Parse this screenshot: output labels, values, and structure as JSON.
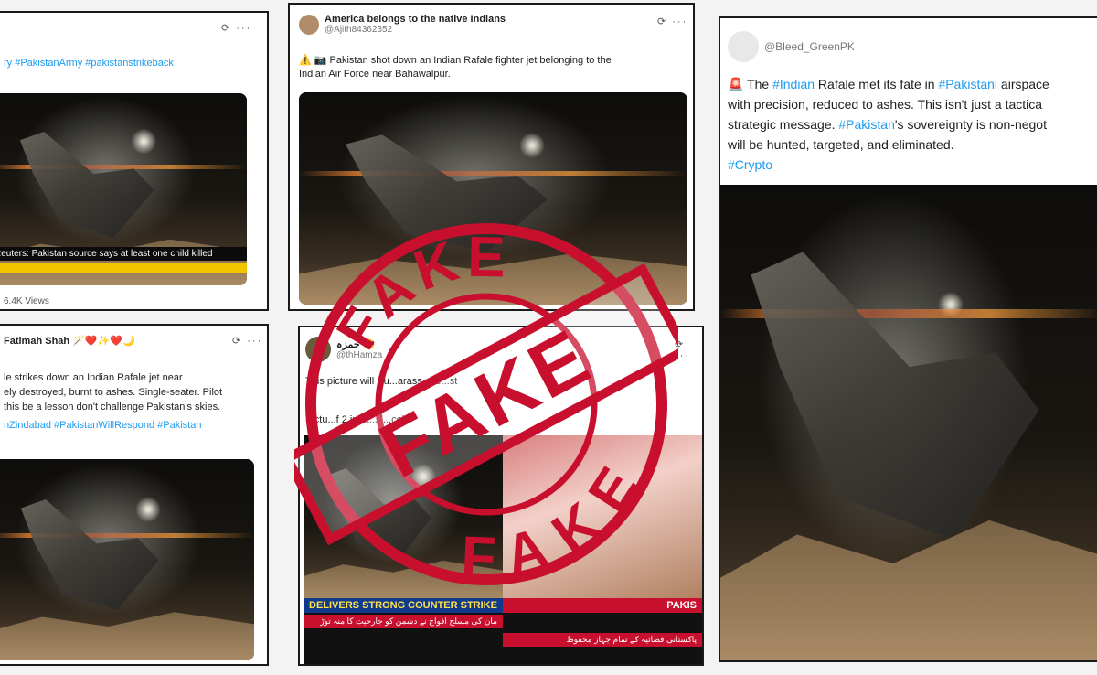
{
  "card1": {
    "tags": "ry #PakistanArmy #pakistanstrikeback",
    "news_banner": "Reuters: Pakistan source says at least one child killed",
    "ticker": "",
    "views": "6.4K Views"
  },
  "card2": {
    "name": "America belongs to the native Indians",
    "handle": "@Ajith84362352",
    "line1": "⚠️ 📷 Pakistan shot down an Indian Rafale fighter jet belonging to the",
    "line2": "Indian Air Force near Bahawalpur."
  },
  "card3": {
    "handle": "@Bleed_GreenPK",
    "line1_a": "🚨 The ",
    "line1_tag1": "#Indian",
    "line1_b": " Rafale met its fate in ",
    "line1_tag2": "#Pakistani",
    "line1_c": " airspace",
    "line2": "with precision, reduced to ashes. This isn't just a tactica",
    "line3_a": "strategic message. ",
    "line3_tag": "#Pakistan",
    "line3_b": "'s sovereignty is non-negot",
    "line4": "will be hunted, targeted, and eliminated.",
    "line5": "#Crypto"
  },
  "card4": {
    "name": "Fatimah Shah 🪄❤️✨❤️🌙",
    "line1": "le strikes down an Indian Rafale jet near",
    "line2": "ely destroyed, burnt to ashes. Single-seater. Pilot",
    "line3": "this be a lesson  don't challenge Pakistan's skies.",
    "line4": "nZindabad #PakistanWillRespond #Pakistan"
  },
  "card5": {
    "name": "حمزہ 😎",
    "handle": "@thHamza",
    "line1": "This picture will Eu...arass...ye...st",
    "line2": "Pictu...f 2 in...t...d...cel",
    "banner_en": "DELIVERS STRONG COUNTER STRIKE",
    "banner_ur1": "مان کی مسلح افواج نے دشمن کو جارحیت کا منہ توڑ",
    "banner_ur2": "پاکستانی فضائیہ کے تمام جہاز محفوظ",
    "channel": "PAKIS"
  },
  "stamp": {
    "center": "FAKE",
    "top_arc": "FAKE",
    "bottom_arc": "FAKE",
    "color": "#c8102e"
  },
  "icons": {
    "card_tools": "grok-icon more-icon"
  }
}
